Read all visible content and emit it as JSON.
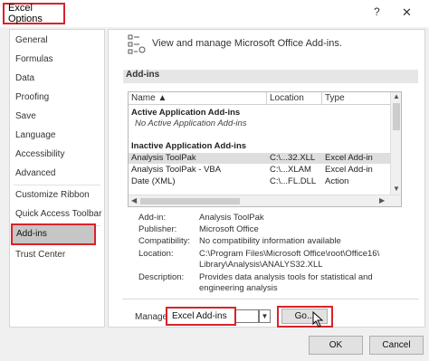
{
  "window": {
    "title": "Excel Options",
    "help_glyph": "?",
    "close_glyph": "✕"
  },
  "sidebar": {
    "items": [
      {
        "label": "General"
      },
      {
        "label": "Formulas"
      },
      {
        "label": "Data"
      },
      {
        "label": "Proofing"
      },
      {
        "label": "Save"
      },
      {
        "label": "Language"
      },
      {
        "label": "Accessibility"
      },
      {
        "label": "Advanced"
      },
      {
        "label": "Customize Ribbon"
      },
      {
        "label": "Quick Access Toolbar"
      },
      {
        "label": "Add-ins"
      },
      {
        "label": "Trust Center"
      }
    ],
    "selected": "Add-ins"
  },
  "main": {
    "header_text": "View and manage Microsoft Office Add-ins.",
    "section_title": "Add-ins",
    "table": {
      "columns": {
        "name": "Name ▲",
        "location": "Location",
        "type": "Type"
      },
      "group_active": "Active Application Add-ins",
      "active_empty": "No Active Application Add-ins",
      "group_inactive": "Inactive Application Add-ins",
      "rows": [
        {
          "name": "Analysis ToolPak",
          "location": "C:\\...32.XLL",
          "type": "Excel Add-in"
        },
        {
          "name": "Analysis ToolPak - VBA",
          "location": "C:\\...XLAM",
          "type": "Excel Add-in"
        },
        {
          "name": "Date (XML)",
          "location": "C:\\...FL.DLL",
          "type": "Action"
        }
      ]
    },
    "details": {
      "addin_label": "Add-in:",
      "addin_value": "Analysis ToolPak",
      "publisher_label": "Publisher:",
      "publisher_value": "Microsoft Office",
      "compat_label": "Compatibility:",
      "compat_value": "No compatibility information available",
      "location_label": "Location:",
      "location_value_1": "C:\\Program Files\\Microsoft Office\\root\\Office16\\",
      "location_value_2": "Library\\Analysis\\ANALYS32.XLL",
      "description_label": "Description:",
      "description_value_1": "Provides data analysis tools for statistical and",
      "description_value_2": "engineering analysis"
    },
    "manage_label": "Manage:",
    "manage_value": "Excel Add-ins",
    "go_label": "Go..."
  },
  "footer": {
    "ok": "OK",
    "cancel": "Cancel"
  },
  "colors": {
    "highlight_border": "#d9232a",
    "selected_bg": "#c6c6c6"
  }
}
